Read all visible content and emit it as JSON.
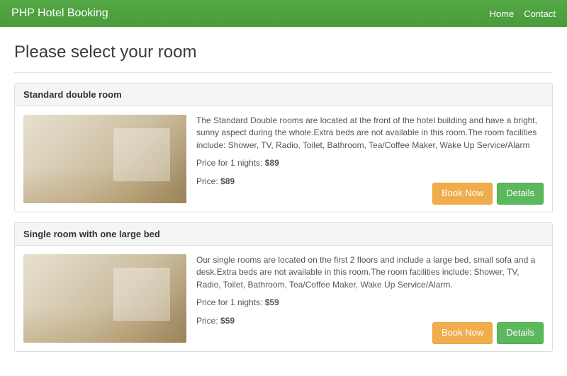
{
  "navbar": {
    "brand": "PHP Hotel Booking",
    "links": [
      {
        "label": "Home"
      },
      {
        "label": "Contact"
      }
    ]
  },
  "page": {
    "title": "Please select your room"
  },
  "rooms": [
    {
      "name": "Standard double room",
      "description": "The Standard Double rooms are located at the front of the hotel building and have a bright, sunny aspect during the whole.Extra beds are not available in this room.The room facilities include: Shower, TV, Radio, Toilet, Bathroom, Tea/Coffee Maker, Wake Up Service/Alarm",
      "price_nights_label": "Price for 1 nights: ",
      "price_nights_value": "$89",
      "price_label": "Price: ",
      "price_value": "$89",
      "book_label": "Book Now",
      "details_label": "Details"
    },
    {
      "name": "Single room with one large bed",
      "description": "Our single rooms are located on the first 2 floors and include a large bed, small sofa and a desk.Extra beds are not available in this room.The room facilities include: Shower, TV, Radio, Toilet, Bathroom, Tea/Coffee Maker, Wake Up Service/Alarm.",
      "price_nights_label": "Price for 1 nights: ",
      "price_nights_value": "$59",
      "price_label": "Price: ",
      "price_value": "$59",
      "book_label": "Book Now",
      "details_label": "Details"
    }
  ]
}
